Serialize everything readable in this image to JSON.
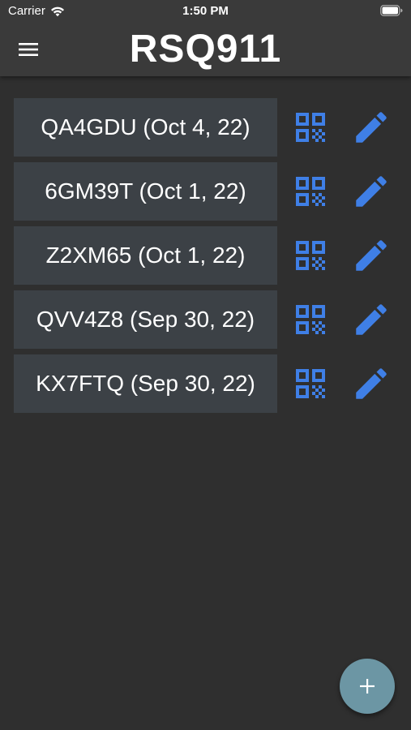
{
  "status_bar": {
    "carrier": "Carrier",
    "time": "1:50 PM"
  },
  "app_bar": {
    "title": "RSQ911",
    "menu_icon": "hamburger-menu-icon"
  },
  "entries": [
    {
      "label": "QA4GDU (Oct 4, 22)"
    },
    {
      "label": "6GM39T (Oct 1, 22)"
    },
    {
      "label": "Z2XM65 (Oct 1, 22)"
    },
    {
      "label": "QVV4Z8 (Sep 30, 22)"
    },
    {
      "label": "KX7FTQ (Sep 30, 22)"
    }
  ],
  "row_icons": {
    "qr": "qr-code-icon",
    "edit": "pencil-icon"
  },
  "fab": {
    "icon": "plus-icon"
  },
  "colors": {
    "background": "#2f2f2f",
    "app_bar": "#3a3a3a",
    "row_background": "#3c4146",
    "accent_icon": "#3f7fe6",
    "fab": "#6c96a4",
    "text": "#ffffff"
  }
}
